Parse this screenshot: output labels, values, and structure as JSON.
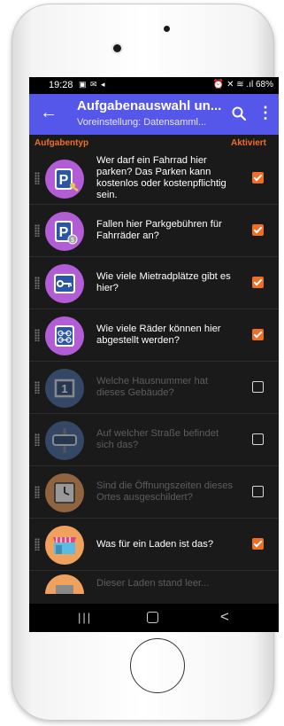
{
  "status": {
    "time": "19:28",
    "left_icons": "▣ ✉ ◂",
    "right": "⏰ ✕ ≋ .ıl 68%"
  },
  "appbar": {
    "back_glyph": "←",
    "title": "Aufgabenauswahl un...",
    "subtitle": "Voreinstellung: Datensamml...",
    "more_glyph": "⋮"
  },
  "columns": {
    "left": "Aufgabentyp",
    "right": "Aktiviert"
  },
  "quests": [
    {
      "text": "Wer darf ein Fahrrad hier parken? Das Parken kann kostenlos oder kostenpflichtig sein.",
      "icon": "bicycle-parking-access-icon",
      "enabled": true
    },
    {
      "text": "Fallen hier Parkgebühren für Fahrräder an?",
      "icon": "bicycle-parking-fee-icon",
      "enabled": true
    },
    {
      "text": "Wie viele Mietradplätze gibt es hier?",
      "icon": "bicycle-rental-capacity-icon",
      "enabled": true
    },
    {
      "text": "Wie viele Räder können hier abgestellt werden?",
      "icon": "bicycle-parking-capacity-icon",
      "enabled": true
    },
    {
      "text": "Welche Hausnummer hat dieses Gebäude?",
      "icon": "housenumber-icon",
      "enabled": false
    },
    {
      "text": "Auf welcher Straße befindet sich das?",
      "icon": "street-sign-icon",
      "enabled": false
    },
    {
      "text": "Sind die Öffnungszeiten dieses Ortes ausgeschildert?",
      "icon": "opening-hours-sign-icon",
      "enabled": false
    },
    {
      "text": "Was für ein Laden ist das?",
      "icon": "shop-icon",
      "enabled": true
    }
  ],
  "partial_row": {
    "text": "Dieser Laden stand leer..."
  },
  "nav": {
    "recent": "|||",
    "back": "<"
  },
  "colors": {
    "accent": "#f06e23",
    "appbar": "#5557ea",
    "icon_purple": "#b25cd6",
    "icon_orange": "#f0a15d",
    "icon_blue": "#4a6fa5",
    "background": "#1a1a1a"
  }
}
